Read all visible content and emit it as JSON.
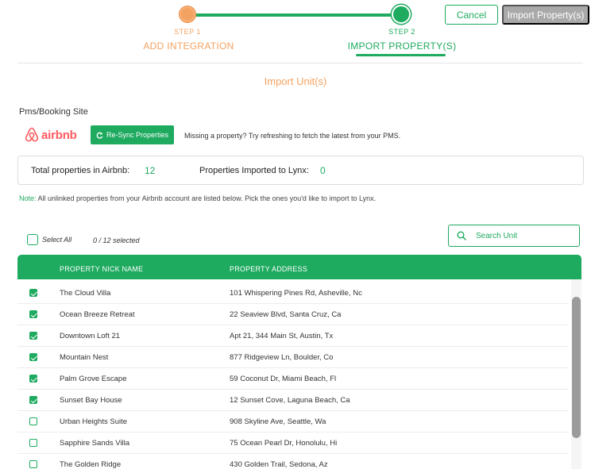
{
  "actions": {
    "cancel_label": "Cancel",
    "import_label": "Import Property(s)"
  },
  "stepper": {
    "step1": {
      "label": "STEP 1",
      "title": "ADD INTEGRATION"
    },
    "step2": {
      "label": "STEP 2",
      "title": "IMPORT PROPERTY(S)"
    },
    "colors": {
      "done": "#f4a261",
      "active": "#1eaa5f"
    }
  },
  "section_title": "Import Unit(s)",
  "pms": {
    "label": "Pms/Booking Site",
    "logo_text": "airbnb",
    "resync_label": "Re-Sync Properties",
    "missing_hint": "Missing a property? Try refreshing to fetch the latest from your PMS."
  },
  "stats": {
    "total_label": "Total properties in Airbnb:",
    "total_value": "12",
    "imported_label": "Properties Imported to Lynx:",
    "imported_value": "0"
  },
  "note": {
    "prefix": "Note:",
    "text": " All unlinked properties from your Airbnb account are listed below. Pick the ones you'd like to import to Lynx."
  },
  "selection": {
    "select_all_label": "Select All",
    "count_text": "0 / 12 selected"
  },
  "search": {
    "placeholder": "Search Unit",
    "value": ""
  },
  "table": {
    "columns": [
      "PROPERTY NICK NAME",
      "PROPERTY ADDRESS"
    ],
    "rows": [
      {
        "checked": true,
        "name": "The Cloud Villa",
        "address": "101 Whispering Pines Rd, Asheville, Nc"
      },
      {
        "checked": true,
        "name": "Ocean Breeze Retreat",
        "address": "22 Seaview Blvd, Santa Cruz, Ca"
      },
      {
        "checked": true,
        "name": "Downtown Loft 21",
        "address": "Apt 21, 344 Main St, Austin, Tx"
      },
      {
        "checked": true,
        "name": "Mountain Nest",
        "address": "877 Ridgeview Ln, Boulder, Co"
      },
      {
        "checked": true,
        "name": "Palm Grove Escape",
        "address": "59 Coconut Dr, Miami Beach, Fl"
      },
      {
        "checked": true,
        "name": "Sunset Bay House",
        "address": "12 Sunset Cove, Laguna Beach, Ca"
      },
      {
        "checked": false,
        "name": "Urban Heights Suite",
        "address": "908 Skyline Ave, Seattle, Wa"
      },
      {
        "checked": false,
        "name": "Sapphire Sands Villa",
        "address": "75 Ocean Pearl Dr, Honolulu, Hi"
      },
      {
        "checked": false,
        "name": "The Golden Ridge",
        "address": "430 Golden Trail, Sedona, Az"
      }
    ]
  },
  "icons": {
    "refresh": "refresh-icon",
    "search": "search-icon",
    "logo": "airbnb-logo-icon"
  },
  "colors": {
    "accent": "#1eaa5f",
    "secondary": "#f4a261",
    "brand_airbnb": "#ff5a5f",
    "disabled": "#a9a9a9"
  }
}
